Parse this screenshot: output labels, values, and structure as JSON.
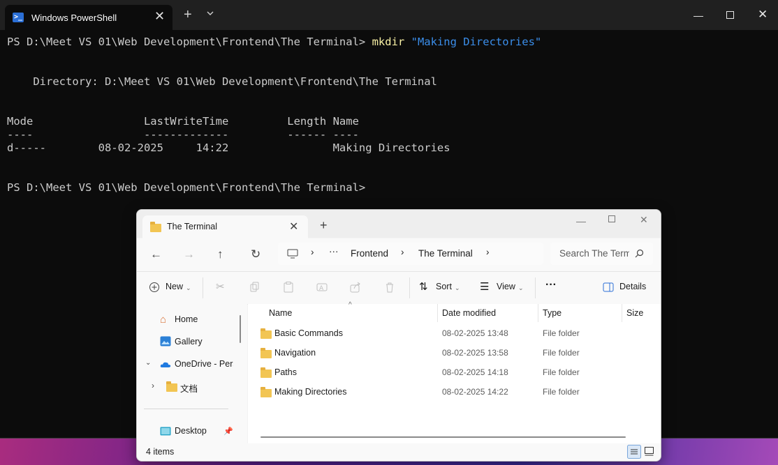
{
  "terminal": {
    "title": "Windows PowerShell",
    "prompt1": "PS D:\\Meet VS 01\\Web Development\\Frontend\\The Terminal> ",
    "cmd_name": "mkdir",
    "cmd_arg": "\"Making Directories\"",
    "directory_line": "    Directory: D:\\Meet VS 01\\Web Development\\Frontend\\The Terminal",
    "header_line": "Mode                 LastWriteTime         Length Name",
    "underline_line": "----                 -------------         ------ ----",
    "result_line": "d-----        08-02-2025     14:22                Making Directories",
    "prompt2": "PS D:\\Meet VS 01\\Web Development\\Frontend\\The Terminal>"
  },
  "explorer": {
    "tab_title": "The Terminal",
    "breadcrumb": [
      "Frontend",
      "The Terminal"
    ],
    "breadcrumb_more": "···",
    "search_placeholder": "Search The Terminal",
    "toolbar": {
      "new_label": "New",
      "sort_label": "Sort",
      "view_label": "View",
      "more_label": "···",
      "details_label": "Details"
    },
    "sidebar": {
      "home": "Home",
      "gallery": "Gallery",
      "onedrive": "OneDrive - Personal",
      "docs": "文档",
      "desktop": "Desktop"
    },
    "columns": {
      "name": "Name",
      "date": "Date modified",
      "type": "Type",
      "size": "Size"
    },
    "files": [
      {
        "name": "Basic Commands",
        "date": "08-02-2025 13:48",
        "type": "File folder"
      },
      {
        "name": "Navigation",
        "date": "08-02-2025 13:58",
        "type": "File folder"
      },
      {
        "name": "Paths",
        "date": "08-02-2025 14:18",
        "type": "File folder"
      },
      {
        "name": "Making Directories",
        "date": "08-02-2025 14:22",
        "type": "File folder"
      }
    ],
    "status": "4 items"
  },
  "icons": {
    "folder_color": "#f2c553",
    "accent_blue": "#3b8eea"
  }
}
